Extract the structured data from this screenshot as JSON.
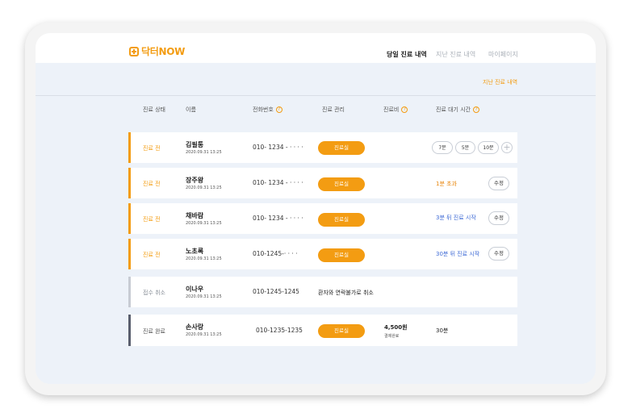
{
  "app": {
    "logo_text": "닥터NOW",
    "brand_color": "#f39c12"
  },
  "nav": {
    "today": "당일 진료 내역",
    "past": "지난 진료 내역",
    "mypage": "마이페이지"
  },
  "past_link": "지난 진료 내역",
  "table": {
    "headers": {
      "status": "진료 상태",
      "name": "이름",
      "phone": "전화번호",
      "manage": "진료 관리",
      "fee": "진료비",
      "wait": "진료 대기 시간"
    },
    "rows": [
      {
        "status": "진료 전",
        "name": "김필통",
        "date": "2020.09.31 13:25",
        "phone": "010- 1234 - · · · ·",
        "action": "진료실",
        "wait_options": [
          "7분",
          "5분",
          "10분"
        ]
      },
      {
        "status": "진료 전",
        "name": "장주왕",
        "date": "2020.09.31 13:25",
        "phone": "010- 1234 - · · · ·",
        "action": "진료실",
        "wait": "1분 초과",
        "edit": "수정"
      },
      {
        "status": "진료 전",
        "name": "채바람",
        "date": "2020.09.31 13:25",
        "phone": "010- 1234 - · · · ·",
        "action": "진료실",
        "wait": "3분 뒤 진료 시작",
        "edit": "수정"
      },
      {
        "status": "진료 전",
        "name": "노초록",
        "date": "2020.09.31 13:25",
        "phone": "010-1245-· · · ·",
        "action": "진료실",
        "wait": "30분 뒤 진료 시작",
        "edit": "수정"
      },
      {
        "status": "접수 취소",
        "name": "이나우",
        "date": "2020.09.31 13:25",
        "phone": "010-1245-1245",
        "memo": "환자와 연락불가로 취소"
      },
      {
        "status": "진료 완료",
        "name": "손사랑",
        "date": "2020.09.31 13:25",
        "phone": "010-1235-1235",
        "action": "진료실",
        "fee": "4,500원",
        "fee_note": "결제완료",
        "wait": "30분"
      }
    ]
  },
  "colors": {
    "accent": "#f39c12",
    "blue": "#3f6bd6",
    "cancel_bar": "#c8ccd4",
    "done_bar": "#5a5f6e"
  }
}
